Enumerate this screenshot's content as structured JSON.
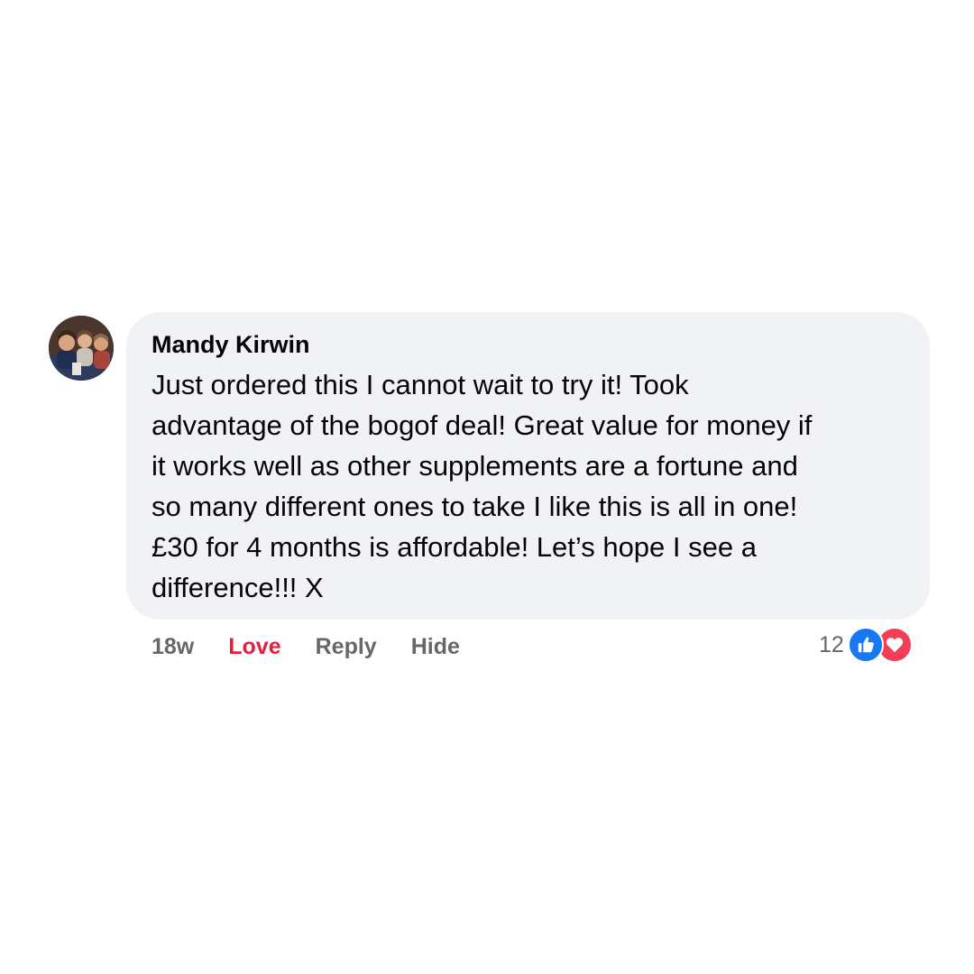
{
  "comment": {
    "author": "Mandy Kirwin",
    "text_lines": [
      "Just ordered this I cannot wait to try it! Took",
      "advantage of the bogof deal! Great value for money if",
      "it works well as other supplements are a fortune and",
      "so many different ones to take I like this is all in one!",
      "£30 for 4 months is affordable! Let’s hope I see a",
      "difference!!! X"
    ]
  },
  "actions": {
    "timestamp": "18w",
    "love_label": "Love",
    "reply_label": "Reply",
    "hide_label": "Hide"
  },
  "reactions": {
    "count": "12",
    "icons": [
      "like-icon",
      "love-icon"
    ]
  },
  "colors": {
    "bubble": "#f0f2f5",
    "love_active": "#e41e3f",
    "like_blue": "#1877f2",
    "heart_red": "#f33e58",
    "muted_text": "#65676b"
  }
}
